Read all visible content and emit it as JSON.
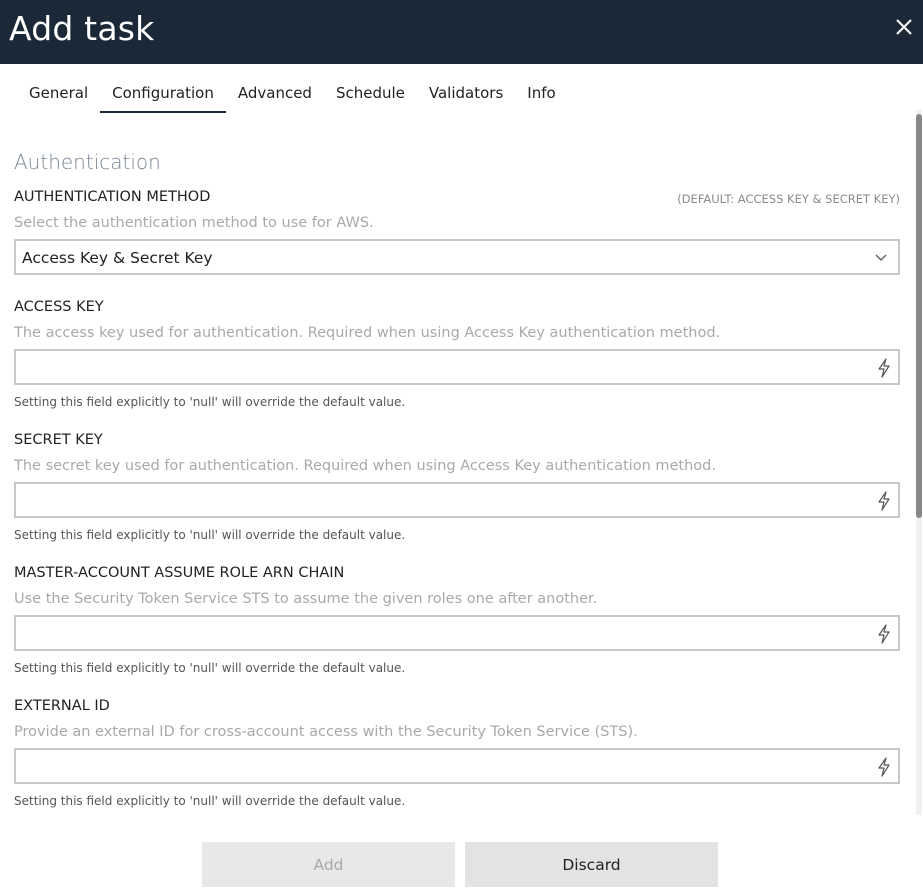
{
  "header": {
    "title": "Add task",
    "close_icon": "close-icon"
  },
  "tabs": [
    {
      "label": "General",
      "active": false
    },
    {
      "label": "Configuration",
      "active": true
    },
    {
      "label": "Advanced",
      "active": false
    },
    {
      "label": "Schedule",
      "active": false
    },
    {
      "label": "Validators",
      "active": false
    },
    {
      "label": "Info",
      "active": false
    }
  ],
  "section": {
    "title": "Authentication"
  },
  "fields": {
    "auth_method": {
      "label": "AUTHENTICATION METHOD",
      "default": "(DEFAULT: ACCESS KEY & SECRET KEY)",
      "description": "Select the authentication method to use for AWS.",
      "value": "Access Key & Secret Key"
    },
    "access_key": {
      "label": "ACCESS KEY",
      "description": "The access key used for authentication. Required when using Access Key authentication method.",
      "value": "",
      "hint": "Setting this field explicitly to 'null' will override the default value."
    },
    "secret_key": {
      "label": "SECRET KEY",
      "description": "The secret key used for authentication. Required when using Access Key authentication method.",
      "value": "",
      "hint": "Setting this field explicitly to 'null' will override the default value."
    },
    "role_chain": {
      "label": "MASTER-ACCOUNT ASSUME ROLE ARN CHAIN",
      "description": "Use the Security Token Service STS to assume the given roles one after another.",
      "value": "",
      "hint": "Setting this field explicitly to 'null' will override the default value."
    },
    "external_id": {
      "label": "EXTERNAL ID",
      "description": "Provide an external ID for cross-account access with the Security Token Service (STS).",
      "value": "",
      "hint": "Setting this field explicitly to 'null' will override the default value."
    }
  },
  "footer": {
    "add_label": "Add",
    "discard_label": "Discard"
  },
  "colors": {
    "header_bg": "#1b2837",
    "muted_text": "#a9a9a9",
    "border": "#c8c8c8"
  }
}
